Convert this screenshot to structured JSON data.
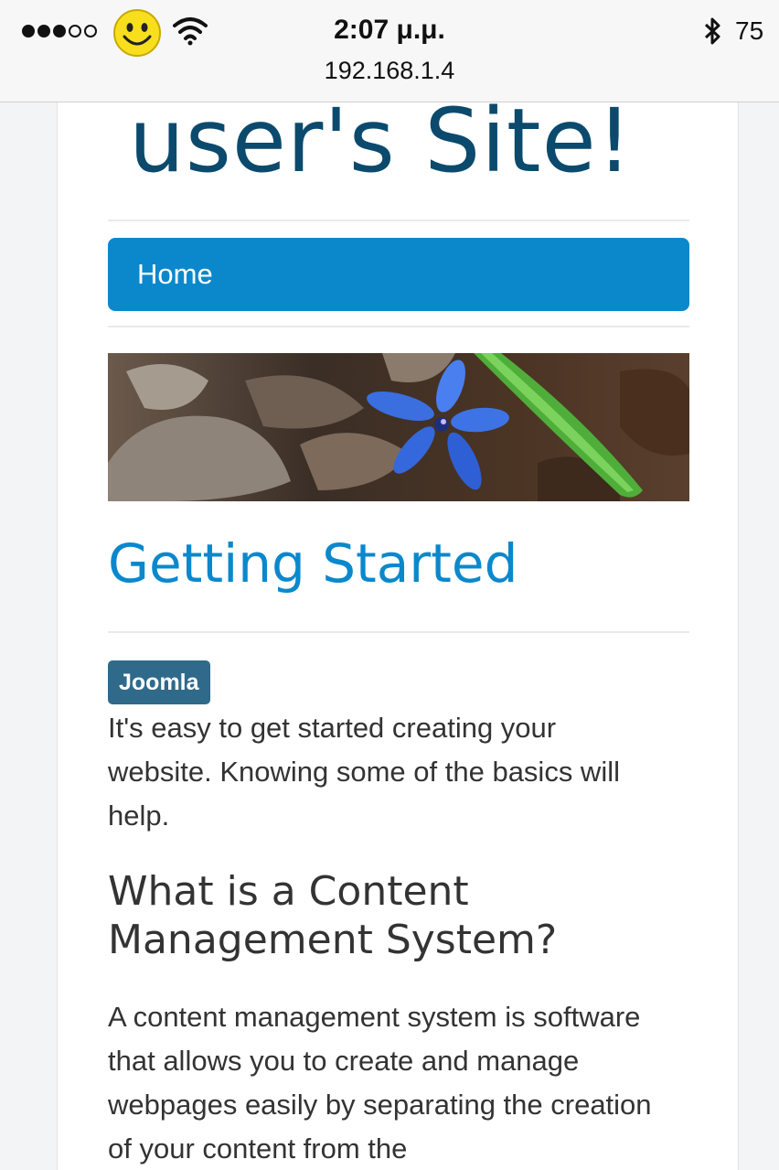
{
  "status_bar": {
    "signal_full": 3,
    "signal_empty": 2,
    "carrier_icon": "smiley-icon",
    "wifi_icon": "wifi-icon",
    "time": "2:07 μ.μ.",
    "address": "192.168.1.4",
    "bluetooth_icon": "bluetooth-icon",
    "battery": "75"
  },
  "site": {
    "title": "user's Site!",
    "nav": {
      "home": "Home"
    },
    "banner_alt": "blue-flower-banner"
  },
  "article": {
    "title": "Getting Started",
    "tag": "Joomla",
    "intro": "It's easy to get started creating your website. Knowing some of the basics will help.",
    "heading": "What is a Content Management System?",
    "body": "A content management system is software that allows you to create and manage webpages easily by separating the creation of your content from the"
  },
  "colors": {
    "site_title": "#0b4a6d",
    "accent": "#0b88cc",
    "tag_bg": "#2f6a8a",
    "text": "#333333"
  }
}
